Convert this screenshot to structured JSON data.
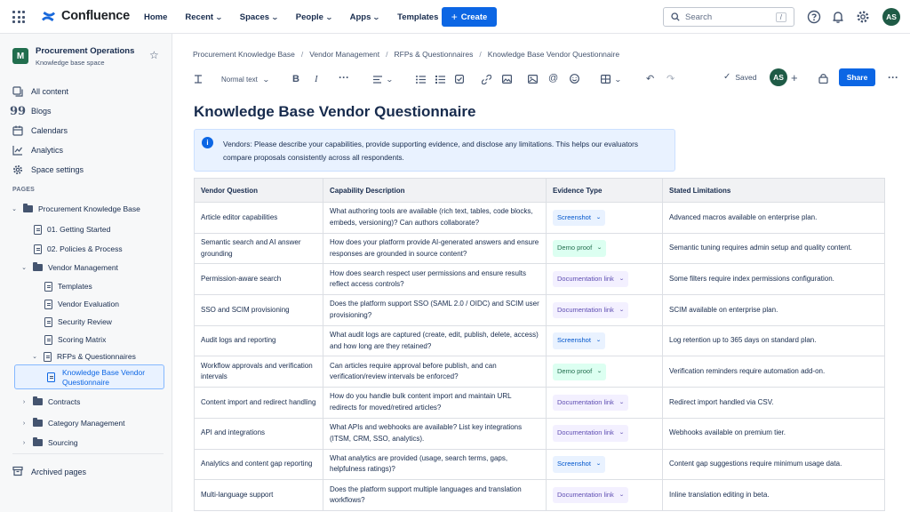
{
  "app": {
    "name": "Confluence",
    "nav": [
      "Home",
      "Recent",
      "Spaces",
      "People",
      "Apps",
      "Templates"
    ],
    "create_label": "Create",
    "search_placeholder": "Search",
    "search_shortcut": "/",
    "user_initials": "AS"
  },
  "sidebar": {
    "space_name": "Procurement Operations",
    "space_type": "Knowledge base space",
    "space_logo": "M",
    "items": [
      "All content",
      "Blogs",
      "Calendars",
      "Analytics",
      "Space settings"
    ],
    "pages_label": "PAGES",
    "tree": [
      {
        "label": "Procurement Knowledge Base"
      },
      {
        "label": "01. Getting Started"
      },
      {
        "label": "02. Policies & Process"
      },
      {
        "label": "Vendor Management"
      },
      {
        "label": "Templates"
      },
      {
        "label": "Vendor Evaluation"
      },
      {
        "label": "Security Review"
      },
      {
        "label": "Scoring Matrix"
      },
      {
        "label": "RFPs & Questionnaires"
      },
      {
        "label": "Knowledge Base Vendor Questionnaire"
      },
      {
        "label": "Contracts"
      },
      {
        "label": "Category Management"
      },
      {
        "label": "Sourcing"
      }
    ],
    "archived_label": "Archived pages"
  },
  "breadcrumb": [
    "Procurement Knowledge Base",
    "Vendor Management",
    "RFPs & Questionnaires",
    "Knowledge Base Vendor Questionnaire"
  ],
  "toolbar": {
    "text_style": "Normal text",
    "saved_label": "Saved",
    "share_label": "Share",
    "collaborator_initials": "AS"
  },
  "page": {
    "title": "Knowledge Base Vendor Questionnaire",
    "info_panel": "Vendors: Please describe your capabilities, provide supporting evidence, and disclose any limitations. This helps our evaluators compare proposals consistently across all respondents."
  },
  "table": {
    "headers": [
      "Vendor Question",
      "Capability Description",
      "Evidence Type",
      "Stated Limitations"
    ],
    "rows": [
      {
        "q": "Article editor capabilities",
        "d": "What authoring tools are available (rich text, tables, code blocks, embeds, versioning)? Can authors collaborate?",
        "e": "Screenshot",
        "color": "blue",
        "l": "Advanced macros available on enterprise plan."
      },
      {
        "q": "Semantic search and AI answer grounding",
        "d": "How does your platform provide AI-generated answers and ensure responses are grounded in source content?",
        "e": "Demo proof",
        "color": "green",
        "l": "Semantic tuning requires admin setup and quality content."
      },
      {
        "q": "Permission-aware search",
        "d": "How does search respect user permissions and ensure results reflect access controls?",
        "e": "Documentation link",
        "color": "purple",
        "l": "Some filters require index permissions configuration."
      },
      {
        "q": "SSO and SCIM provisioning",
        "d": "Does the platform support SSO (SAML 2.0 / OIDC) and SCIM user provisioning?",
        "e": "Documentation link",
        "color": "purple",
        "l": "SCIM available on enterprise plan."
      },
      {
        "q": "Audit logs and reporting",
        "d": "What audit logs are captured (create, edit, publish, delete, access) and how long are they retained?",
        "e": "Screenshot",
        "color": "blue",
        "l": "Log retention up to 365 days on standard plan."
      },
      {
        "q": "Workflow approvals and verification intervals",
        "d": "Can articles require approval before publish, and can verification/review intervals be enforced?",
        "e": "Demo proof",
        "color": "green",
        "l": "Verification reminders require automation add-on."
      },
      {
        "q": "Content import and redirect handling",
        "d": "How do you handle bulk content import and maintain URL redirects for moved/retired articles?",
        "e": "Documentation link",
        "color": "purple",
        "l": "Redirect import handled via CSV."
      },
      {
        "q": "API and integrations",
        "d": "What APIs and webhooks are available? List key integrations (ITSM, CRM, SSO, analytics).",
        "e": "Documentation link",
        "color": "purple",
        "l": "Webhooks available on premium tier."
      },
      {
        "q": "Analytics and content gap reporting",
        "d": "What analytics are provided (usage, search terms, gaps, helpfulness ratings)?",
        "e": "Screenshot",
        "color": "blue",
        "l": "Content gap suggestions require minimum usage data."
      },
      {
        "q": "Multi-language support",
        "d": "Does the platform support multiple languages and translation workflows?",
        "e": "Documentation link",
        "color": "purple",
        "l": "Inline translation editing in beta."
      }
    ]
  }
}
